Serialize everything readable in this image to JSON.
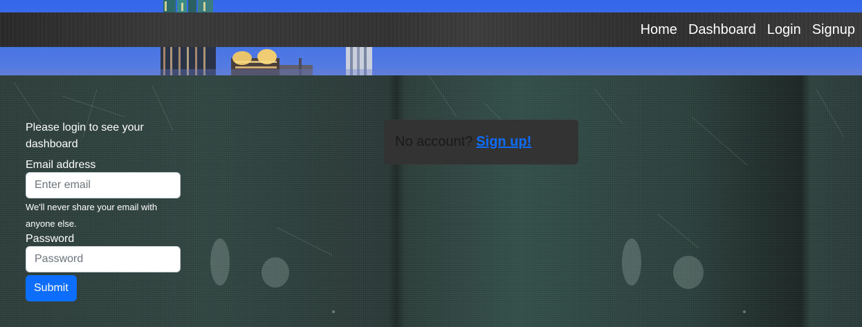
{
  "nav": {
    "items": [
      "Home",
      "Dashboard",
      "Login",
      "Signup"
    ]
  },
  "login_form": {
    "intro": "Please login to see your dashboard",
    "email_label": "Email address",
    "email_placeholder": "Enter email",
    "email_help": "We'll never share your email with anyone else.",
    "password_label": "Password",
    "password_placeholder": "Password",
    "submit_label": "Submit"
  },
  "signup_prompt": {
    "prefix": "No account?",
    "link": "Sign up!"
  },
  "colors": {
    "primary": "#0d6efd",
    "navbar": "#333333",
    "hero_sky": "#3466ea"
  }
}
